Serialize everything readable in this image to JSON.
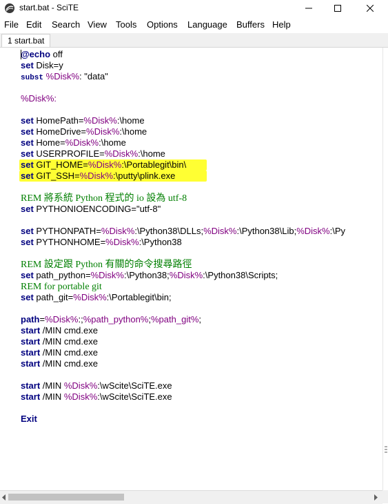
{
  "window": {
    "title": "start.bat - SciTE",
    "minimize_glyph": "minimize-icon",
    "maximize_glyph": "maximize-icon",
    "close_glyph": "close-icon"
  },
  "menu": {
    "items": [
      "File",
      "Edit",
      "Search",
      "View",
      "Tools",
      "Options",
      "Language",
      "Buffers",
      "Help"
    ]
  },
  "tabs": [
    {
      "label": "1 start.bat"
    }
  ],
  "editor": {
    "highlight_color": "#ffff33",
    "keyword_color": "#00007f",
    "variable_color": "#800080",
    "comment_color": "#007f00",
    "lines": [
      {
        "segments": [
          {
            "c": "kw",
            "t": "@echo"
          },
          {
            "c": "",
            "t": " off"
          }
        ]
      },
      {
        "segments": [
          {
            "c": "kw",
            "t": "set"
          },
          {
            "c": "",
            "t": " Disk=y"
          }
        ]
      },
      {
        "segments": [
          {
            "c": "mono-kw",
            "t": "subst"
          },
          {
            "c": "",
            "t": " "
          },
          {
            "c": "var",
            "t": "%Disk%"
          },
          {
            "c": "",
            "t": ": \"data\""
          }
        ]
      },
      {
        "segments": []
      },
      {
        "segments": [
          {
            "c": "var",
            "t": "%Disk%:"
          }
        ]
      },
      {
        "segments": []
      },
      {
        "segments": [
          {
            "c": "kw",
            "t": "set"
          },
          {
            "c": "",
            "t": " HomePath="
          },
          {
            "c": "var",
            "t": "%Disk%"
          },
          {
            "c": "",
            "t": ":\\home"
          }
        ]
      },
      {
        "segments": [
          {
            "c": "kw",
            "t": "set"
          },
          {
            "c": "",
            "t": " HomeDrive="
          },
          {
            "c": "var",
            "t": "%Disk%"
          },
          {
            "c": "",
            "t": ":\\home"
          }
        ]
      },
      {
        "segments": [
          {
            "c": "kw",
            "t": "set"
          },
          {
            "c": "",
            "t": " Home="
          },
          {
            "c": "var",
            "t": "%Disk%"
          },
          {
            "c": "",
            "t": ":\\home"
          }
        ]
      },
      {
        "segments": [
          {
            "c": "kw",
            "t": "set"
          },
          {
            "c": "",
            "t": " USERPROFILE="
          },
          {
            "c": "var",
            "t": "%Disk%"
          },
          {
            "c": "",
            "t": ":\\home"
          }
        ]
      },
      {
        "highlight": true,
        "segments": [
          {
            "c": "kw",
            "t": "set"
          },
          {
            "c": "",
            "t": " GIT_HOME="
          },
          {
            "c": "var",
            "t": "%Disk%"
          },
          {
            "c": "",
            "t": ":\\Portablegit\\bin\\"
          }
        ]
      },
      {
        "highlight": true,
        "segments": [
          {
            "c": "kw",
            "t": "set"
          },
          {
            "c": "",
            "t": " GIT_SSH="
          },
          {
            "c": "var",
            "t": "%Disk%"
          },
          {
            "c": "",
            "t": ":\\putty\\plink.exe"
          }
        ]
      },
      {
        "segments": []
      },
      {
        "segments": [
          {
            "c": "rem",
            "t": "REM 將系統 Python 程式的 io 設為 utf-8"
          }
        ]
      },
      {
        "segments": [
          {
            "c": "kw",
            "t": "set"
          },
          {
            "c": "",
            "t": " PYTHONIOENCODING=\"utf-8\""
          }
        ]
      },
      {
        "segments": []
      },
      {
        "segments": [
          {
            "c": "kw",
            "t": "set"
          },
          {
            "c": "",
            "t": " PYTHONPATH="
          },
          {
            "c": "var",
            "t": "%Disk%"
          },
          {
            "c": "",
            "t": ":\\Python38\\DLLs;"
          },
          {
            "c": "var",
            "t": "%Disk%"
          },
          {
            "c": "",
            "t": ":\\Python38\\Lib;"
          },
          {
            "c": "var",
            "t": "%Disk%"
          },
          {
            "c": "",
            "t": ":\\Py"
          }
        ]
      },
      {
        "segments": [
          {
            "c": "kw",
            "t": "set"
          },
          {
            "c": "",
            "t": " PYTHONHOME="
          },
          {
            "c": "var",
            "t": "%Disk%"
          },
          {
            "c": "",
            "t": ":\\Python38"
          }
        ]
      },
      {
        "segments": []
      },
      {
        "segments": [
          {
            "c": "rem",
            "t": "REM 設定跟 Python 有關的命令搜尋路徑"
          }
        ]
      },
      {
        "segments": [
          {
            "c": "kw",
            "t": "set"
          },
          {
            "c": "",
            "t": " path_python="
          },
          {
            "c": "var",
            "t": "%Disk%"
          },
          {
            "c": "",
            "t": ":\\Python38;"
          },
          {
            "c": "var",
            "t": "%Disk%"
          },
          {
            "c": "",
            "t": ":\\Python38\\Scripts;"
          }
        ]
      },
      {
        "segments": [
          {
            "c": "rem",
            "t": "REM for portable git"
          }
        ]
      },
      {
        "segments": [
          {
            "c": "kw",
            "t": "set"
          },
          {
            "c": "",
            "t": " path_git="
          },
          {
            "c": "var",
            "t": "%Disk%"
          },
          {
            "c": "",
            "t": ":\\Portablegit\\bin;"
          }
        ]
      },
      {
        "segments": []
      },
      {
        "segments": [
          {
            "c": "kw",
            "t": "path"
          },
          {
            "c": "",
            "t": "="
          },
          {
            "c": "var",
            "t": "%Disk%"
          },
          {
            "c": "",
            "t": ":;"
          },
          {
            "c": "var",
            "t": "%path_python%"
          },
          {
            "c": "",
            "t": ";"
          },
          {
            "c": "var",
            "t": "%path_git%"
          },
          {
            "c": "",
            "t": ";"
          }
        ]
      },
      {
        "segments": [
          {
            "c": "kw",
            "t": "start"
          },
          {
            "c": "",
            "t": " /MIN cmd.exe"
          }
        ]
      },
      {
        "segments": [
          {
            "c": "kw",
            "t": "start"
          },
          {
            "c": "",
            "t": " /MIN cmd.exe"
          }
        ]
      },
      {
        "segments": [
          {
            "c": "kw",
            "t": "start"
          },
          {
            "c": "",
            "t": " /MIN cmd.exe"
          }
        ]
      },
      {
        "segments": [
          {
            "c": "kw",
            "t": "start"
          },
          {
            "c": "",
            "t": " /MIN cmd.exe"
          }
        ]
      },
      {
        "segments": []
      },
      {
        "segments": [
          {
            "c": "kw",
            "t": "start"
          },
          {
            "c": "",
            "t": " /MIN "
          },
          {
            "c": "var",
            "t": "%Disk%"
          },
          {
            "c": "",
            "t": ":\\wScite\\SciTE.exe"
          }
        ]
      },
      {
        "segments": [
          {
            "c": "kw",
            "t": "start"
          },
          {
            "c": "",
            "t": " /MIN "
          },
          {
            "c": "var",
            "t": "%Disk%"
          },
          {
            "c": "",
            "t": ":\\wScite\\SciTE.exe"
          }
        ]
      },
      {
        "segments": []
      },
      {
        "segments": [
          {
            "c": "kw",
            "t": "Exit"
          }
        ]
      }
    ]
  }
}
